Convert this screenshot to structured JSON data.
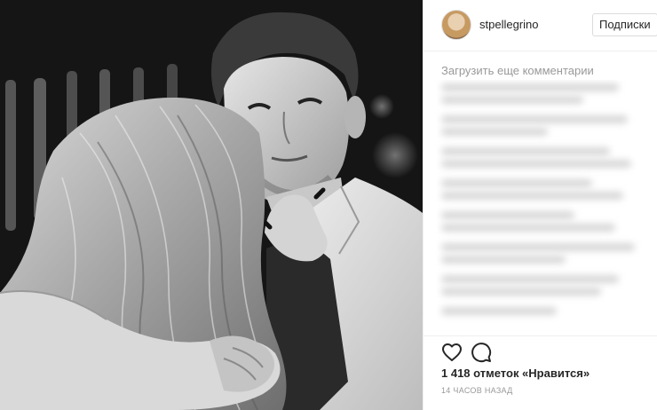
{
  "post": {
    "image_alt": "",
    "author": {
      "username": "stpellegrino"
    },
    "follow_label": "Подписки",
    "load_more_comments": "Загрузить еще комментарии",
    "likes_text": "1 418 отметок «Нравится»",
    "timestamp": "14 часов назад"
  },
  "icons": {
    "like": "heart-icon",
    "comment": "comment-icon"
  }
}
